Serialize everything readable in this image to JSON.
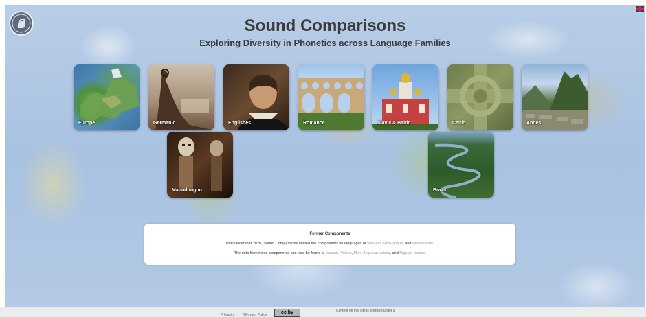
{
  "header": {
    "title": "Sound Comparisons",
    "subtitle": "Exploring Diversity in Phonetics across Language Families"
  },
  "language_icon": "uk-flag-icon",
  "families": [
    {
      "label": "Europe"
    },
    {
      "label": "Germanic"
    },
    {
      "label": "Englishes"
    },
    {
      "label": "Romance"
    },
    {
      "label": "Slavic & Baltic"
    },
    {
      "label": "Celtic"
    },
    {
      "label": "Andes"
    },
    {
      "label": "Mapudungun"
    },
    {
      "label": "Brazil"
    }
  ],
  "former": {
    "heading": "Former Components",
    "p1_pre": "Until December 2020, Sound Comparisons hosted the components on languages of ",
    "p1_link1": "Vanuatu",
    "p1_sep1": ", ",
    "p1_link2": "Mixe-Zoque",
    "p1_sep2": ", and ",
    "p1_link3": "West Papua",
    "p1_post": ".",
    "p2_pre": "The data from these components can now be found at ",
    "p2_link1": "Vanuatu Voices",
    "p2_sep1": ", ",
    "p2_link2": "Mixe-Zoquean Voices",
    "p2_sep2": ", and ",
    "p2_link3": "Papuan Voices",
    "p2_post": "."
  },
  "footer": {
    "imprint": "§ Imprint",
    "privacy": "§ Privacy Policy",
    "license_badge": "cc by",
    "license_text": "Content on this site is licensed under a"
  }
}
